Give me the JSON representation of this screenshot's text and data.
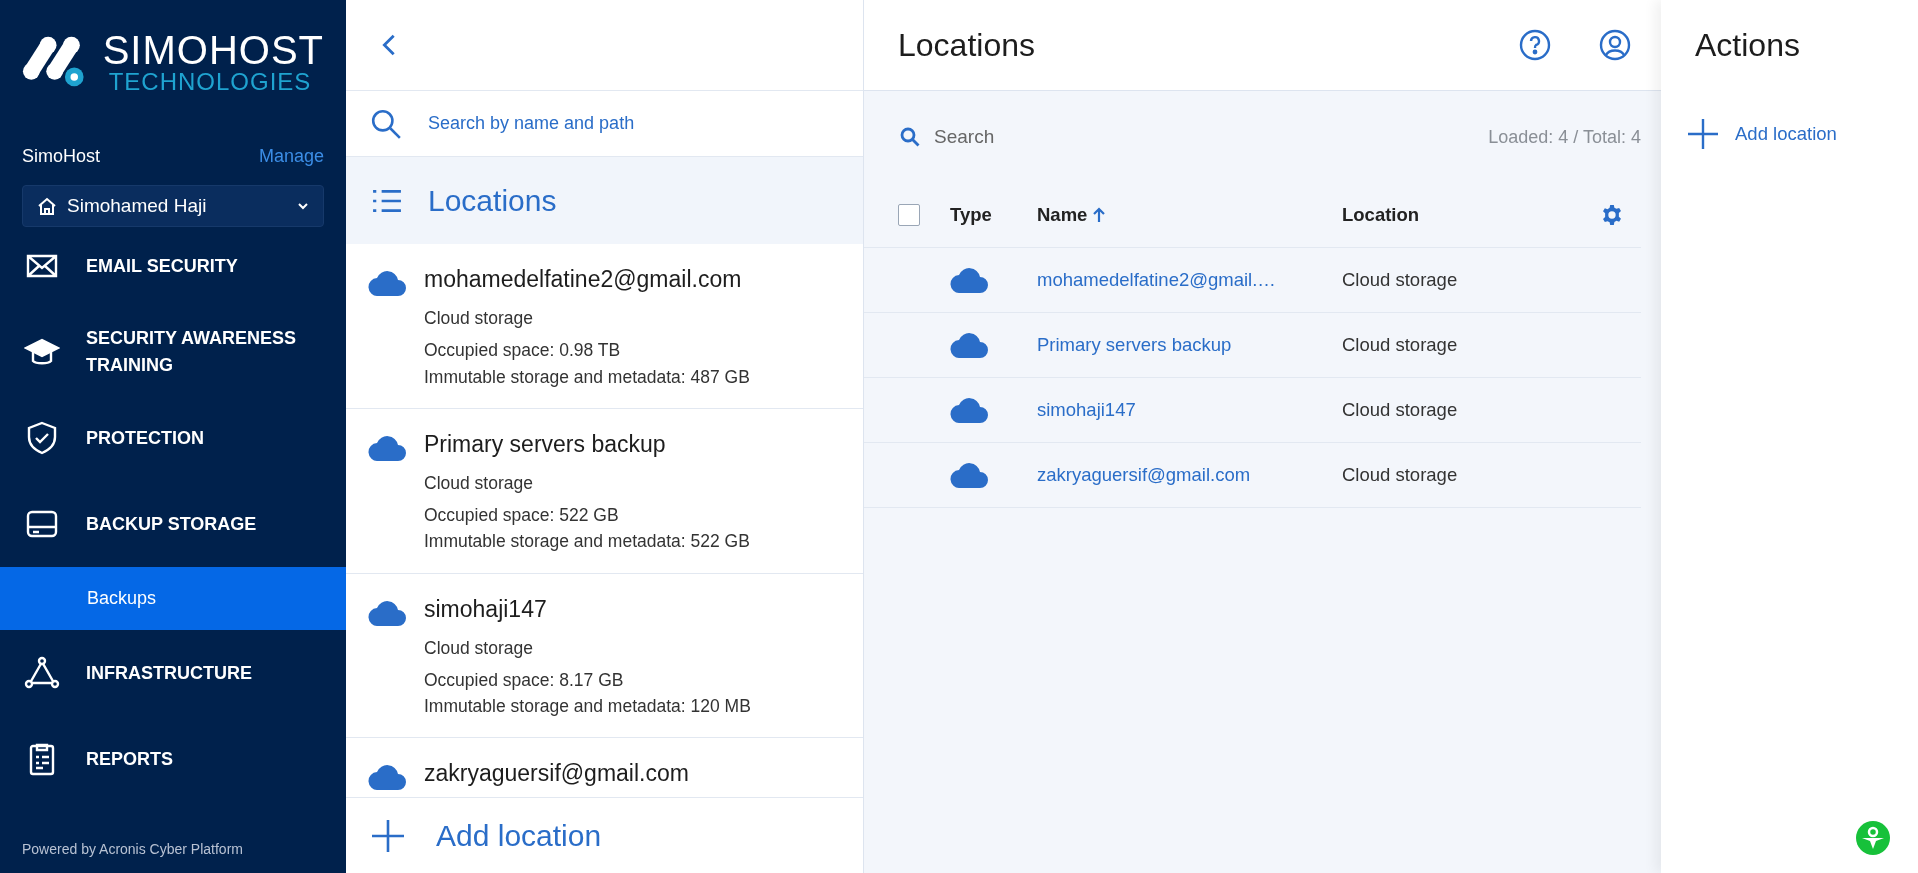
{
  "sidebar": {
    "logo": {
      "line1": "SIMOHOST",
      "line2": "TECHNOLOGIES"
    },
    "account": "SimoHost",
    "manage": "Manage",
    "tenant": "Simohamed Haji",
    "nav": [
      {
        "label": "EMAIL SECURITY",
        "selected": false
      },
      {
        "label": "SECURITY AWARENESS TRAINING",
        "selected": false
      },
      {
        "label": "PROTECTION",
        "selected": false
      },
      {
        "label": "BACKUP STORAGE",
        "selected": false,
        "children": [
          {
            "label": "Backups",
            "selected": true
          }
        ]
      },
      {
        "label": "INFRASTRUCTURE",
        "selected": false
      },
      {
        "label": "REPORTS",
        "selected": false
      }
    ],
    "footer": "Powered by Acronis Cyber Platform"
  },
  "list_panel": {
    "search": {
      "placeholder": "Search by name and path"
    },
    "heading": "Locations",
    "cards": [
      {
        "name": "mohamedelfatine2@gmail.com",
        "type": "Cloud storage",
        "occupied": "Occupied space: 0.98 TB",
        "immutable": "Immutable storage and metadata: 487 GB"
      },
      {
        "name": "Primary servers backup",
        "type": "Cloud storage",
        "occupied": "Occupied space: 522 GB",
        "immutable": "Immutable storage and metadata: 522 GB"
      },
      {
        "name": "simohaji147",
        "type": "Cloud storage",
        "occupied": "Occupied space: 8.17 GB",
        "immutable": "Immutable storage and metadata: 120 MB"
      },
      {
        "name": "zakryaguersif@gmail.com"
      }
    ],
    "add": "Add location"
  },
  "main": {
    "title": "Locations",
    "search": {
      "placeholder": "Search"
    },
    "counter": "Loaded: 4 / Total: 4",
    "table": {
      "select_all": {
        "checked": false
      },
      "columns": [
        {
          "label": "Type",
          "sorted": false
        },
        {
          "label": "Name",
          "sorted": true
        },
        {
          "label": "Location",
          "sorted": false
        }
      ],
      "rows": [
        {
          "name": "mohamedelfatine2@gmail.…",
          "location": "Cloud storage"
        },
        {
          "name": "Primary servers backup",
          "location": "Cloud storage"
        },
        {
          "name": "simohaji147",
          "location": "Cloud storage"
        },
        {
          "name": "zakryaguersif@gmail.com",
          "location": "Cloud storage"
        }
      ]
    }
  },
  "actions": {
    "title": "Actions",
    "items": [
      {
        "label": "Add location"
      }
    ]
  }
}
